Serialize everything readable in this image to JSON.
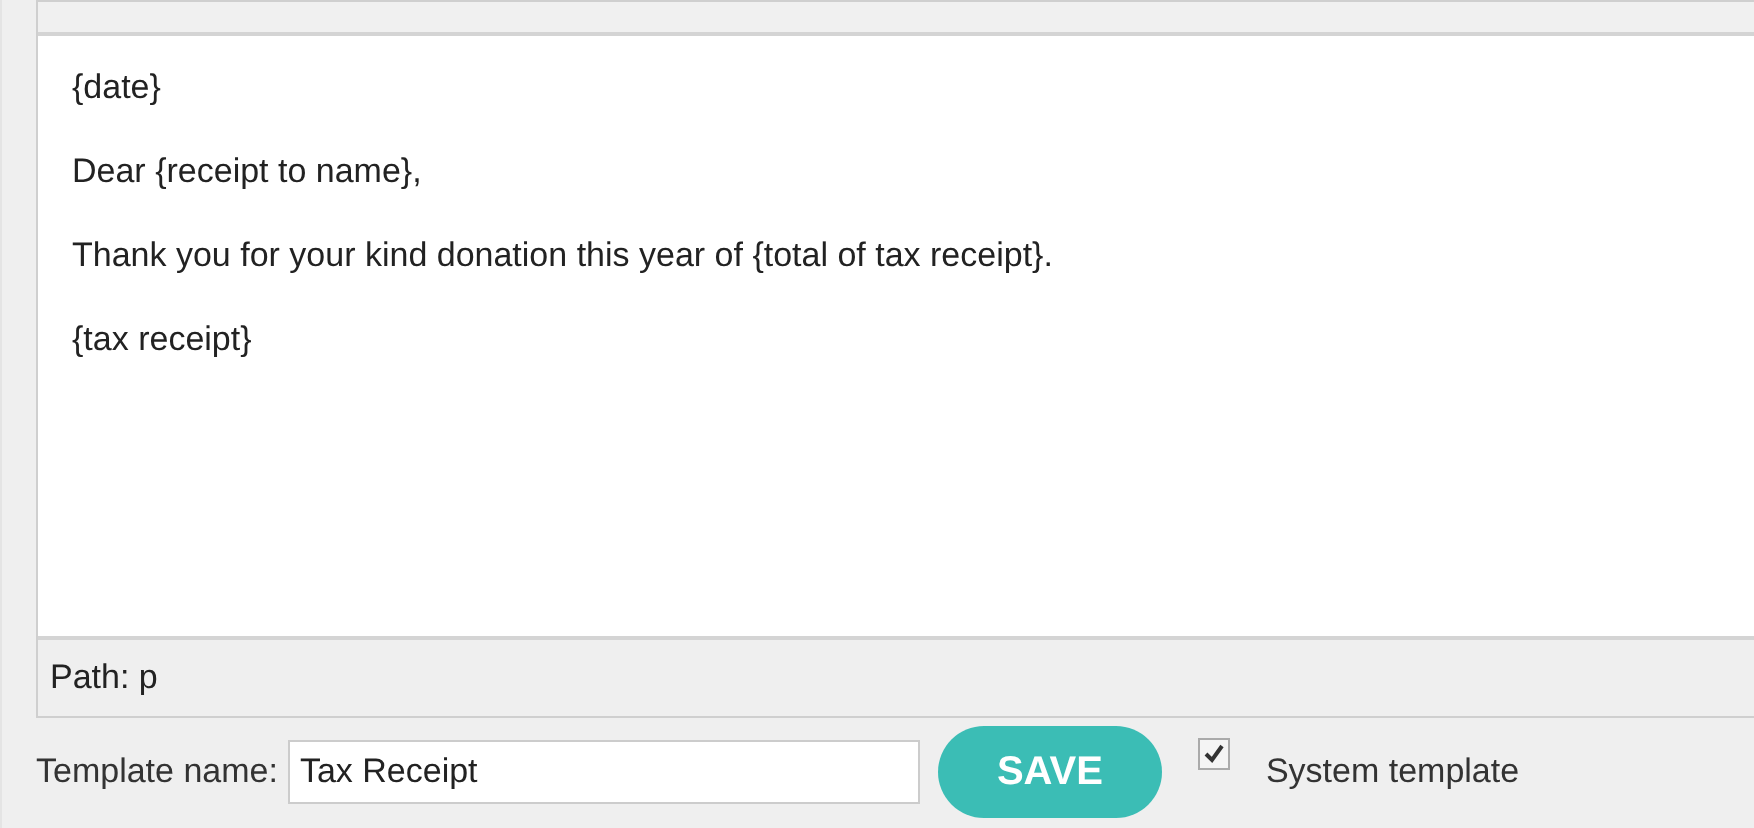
{
  "editor": {
    "paragraphs": [
      "{date}",
      "Dear {receipt to name},",
      "Thank you for your kind donation this year of {total of tax receipt}.",
      "{tax receipt}"
    ],
    "path": "Path: p"
  },
  "footer": {
    "name_label": "Template name:",
    "name_value": "Tax Receipt",
    "save": "SAVE",
    "system_label": "System template",
    "system_checked": true
  }
}
